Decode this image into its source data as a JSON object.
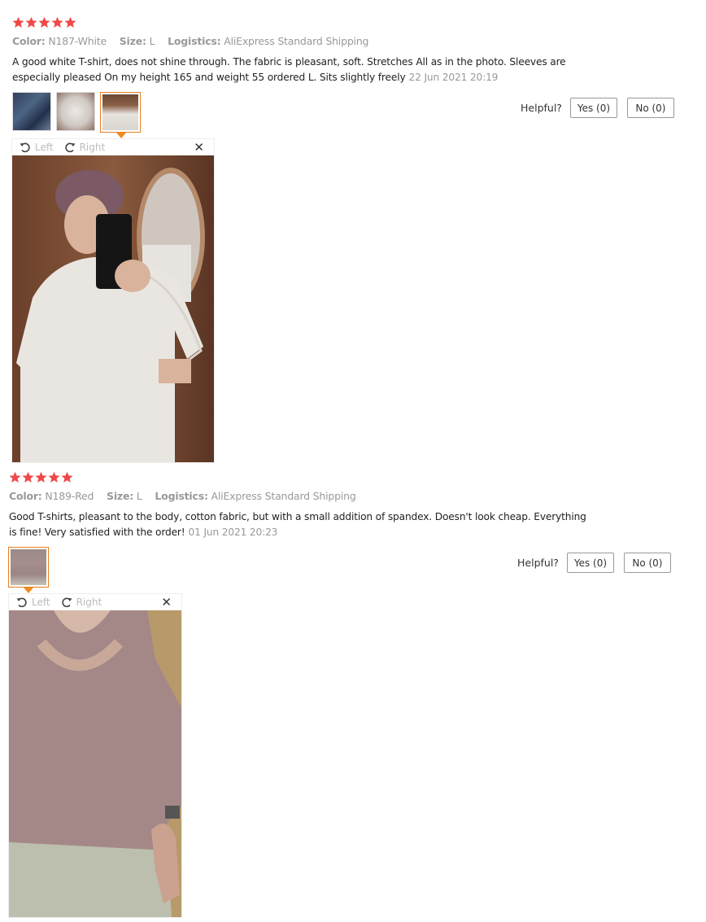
{
  "colors": {
    "star": "#f04848",
    "accent": "#f08c1e"
  },
  "reviews": [
    {
      "rating": 5,
      "color_label": "Color:",
      "color_value": "N187-White",
      "size_label": "Size:",
      "size_value": "L",
      "logistics_label": "Logistics:",
      "logistics_value": "AliExpress Standard Shipping",
      "text": "A good white T-shirt, does not shine through. The fabric is pleasant, soft. Stretches All as in the photo. Sleeves are especially pleased On my height 165 and weight 55 ordered L. Sits slightly freely",
      "date": "22 Jun 2021 20:19",
      "helpful_label": "Helpful?",
      "yes_label": "Yes (0)",
      "no_label": "No (0)",
      "viewer": {
        "left_label": "Left",
        "right_label": "Right",
        "close_icon": "close-icon"
      }
    },
    {
      "rating": 5,
      "color_label": "Color:",
      "color_value": "N189-Red",
      "size_label": "Size:",
      "size_value": "L",
      "logistics_label": "Logistics:",
      "logistics_value": "AliExpress Standard Shipping",
      "text": "Good T-shirts, pleasant to the body, cotton fabric, but with a small addition of spandex. Doesn't look cheap. Everything is fine! Very satisfied with the order!",
      "date": "01 Jun 2021 20:23",
      "helpful_label": "Helpful?",
      "yes_label": "Yes (0)",
      "no_label": "No (0)",
      "viewer": {
        "left_label": "Left",
        "right_label": "Right",
        "close_icon": "close-icon"
      }
    }
  ]
}
